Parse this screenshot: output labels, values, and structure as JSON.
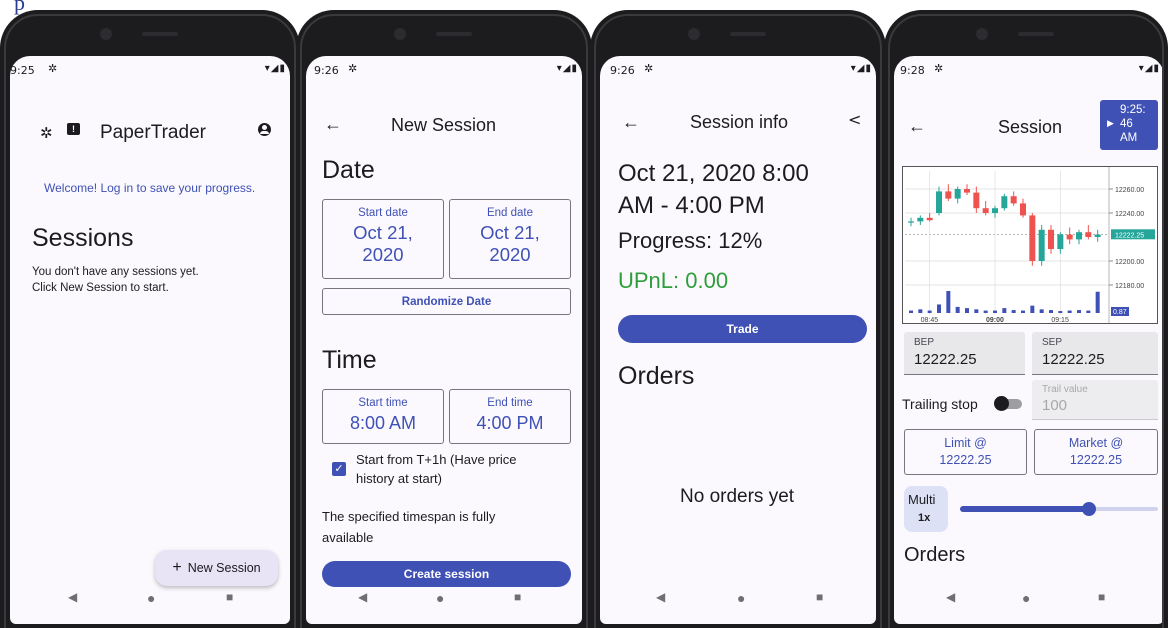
{
  "top_peek_text": "p",
  "status": {
    "s1_time": "9:25",
    "s2_time": "9:26",
    "s3_time": "9:26",
    "s4_time": "9:28"
  },
  "screen1": {
    "app_title": "PaperTrader",
    "welcome": "Welcome! Log in to save your progress.",
    "heading": "Sessions",
    "empty_line1": "You don't have any sessions yet.",
    "empty_line2": "Click New Session to start.",
    "fab_label": "New Session"
  },
  "screen2": {
    "title": "New Session",
    "date_heading": "Date",
    "start_date_label": "Start date",
    "start_date_line1": "Oct 21,",
    "start_date_line2": "2020",
    "end_date_label": "End date",
    "end_date_line1": "Oct 21,",
    "end_date_line2": "2020",
    "randomize_label": "Randomize Date",
    "time_heading": "Time",
    "start_time_label": "Start time",
    "start_time_value": "8:00 AM",
    "end_time_label": "End time",
    "end_time_value": "4:00 PM",
    "checkbox_line1": "Start from T+1h (Have price",
    "checkbox_line2": "history at start)",
    "checkbox_checked": true,
    "availability_line1": "The specified timespan is fully",
    "availability_line2": "available",
    "create_label": "Create session"
  },
  "screen3": {
    "title": "Session info",
    "range_line1": "Oct 21, 2020 8:00",
    "range_line2": "AM - 4:00 PM",
    "progress": "Progress: 12%",
    "upnl": "UPnL: 0.00",
    "trade_label": "Trade",
    "orders_heading": "Orders",
    "empty_orders": "No orders yet"
  },
  "screen4": {
    "title": "Session",
    "clock_line1": "9:25:",
    "clock_line2": "46",
    "clock_line3": "AM",
    "bep_label": "BEP",
    "bep_value": "12222.25",
    "sep_label": "SEP",
    "sep_value": "12222.25",
    "trailing_stop_label": "Trailing stop",
    "trailing_stop_on": false,
    "trail_value_label": "Trail value",
    "trail_value_placeholder": "100",
    "limit_line1": "Limit @",
    "limit_line2": "12222.25",
    "market_line1": "Market @",
    "market_line2": "12222.25",
    "multi_label": "Multi",
    "multi_value": "1x",
    "multiplier_fraction": 0.65,
    "orders_heading": "Orders"
  },
  "chart_data": {
    "type": "candlestick",
    "y_ticks": [
      "12260.00",
      "12240.00",
      "12222.25",
      "12200.00",
      "12180.00"
    ],
    "current_price": "12222.25",
    "volume_label": "0.87",
    "x_ticks": [
      "08:45",
      "09:00",
      "09:15"
    ],
    "ylim": [
      12165,
      12275
    ],
    "candles": [
      [
        12232,
        12236,
        12229,
        12233
      ],
      [
        12233,
        12238,
        12230,
        12236
      ],
      [
        12236,
        12240,
        12233,
        12234
      ],
      [
        12240,
        12262,
        12238,
        12258
      ],
      [
        12258,
        12264,
        12250,
        12252
      ],
      [
        12252,
        12262,
        12248,
        12260
      ],
      [
        12260,
        12264,
        12255,
        12257
      ],
      [
        12257,
        12262,
        12240,
        12244
      ],
      [
        12244,
        12250,
        12238,
        12240
      ],
      [
        12240,
        12246,
        12236,
        12244
      ],
      [
        12244,
        12256,
        12242,
        12254
      ],
      [
        12254,
        12258,
        12246,
        12248
      ],
      [
        12248,
        12252,
        12236,
        12238
      ],
      [
        12238,
        12240,
        12196,
        12200
      ],
      [
        12200,
        12230,
        12196,
        12226
      ],
      [
        12226,
        12230,
        12206,
        12210
      ],
      [
        12210,
        12224,
        12206,
        12222
      ],
      [
        12222,
        12228,
        12214,
        12218
      ],
      [
        12218,
        12226,
        12214,
        12224
      ],
      [
        12224,
        12230,
        12218,
        12220
      ],
      [
        12220,
        12226,
        12216,
        12222
      ]
    ],
    "up_color": "#26a69a",
    "down_color": "#ef5350",
    "volume_color": "#3f51b5",
    "volumes": [
      0.1,
      0.15,
      0.1,
      0.35,
      0.9,
      0.25,
      0.2,
      0.15,
      0.1,
      0.1,
      0.2,
      0.12,
      0.1,
      0.3,
      0.15,
      0.12,
      0.08,
      0.1,
      0.12,
      0.1,
      0.87
    ]
  },
  "colors": {
    "accent": "#3f51b5",
    "upnl": "#2e9e3a",
    "fab_bg": "#e8e4f6"
  },
  "icons": {
    "settings": "gear-icon",
    "feedback": "feedback-icon",
    "account": "account-icon",
    "back": "back-arrow-icon",
    "share": "share-icon",
    "add": "plus-icon",
    "play": "play-icon",
    "nav_back": "nav-back-icon",
    "nav_home": "nav-home-icon",
    "nav_recents": "nav-recents-icon"
  },
  "nav_glyphs": {
    "back": "◀",
    "home": "●",
    "recents": "■"
  }
}
